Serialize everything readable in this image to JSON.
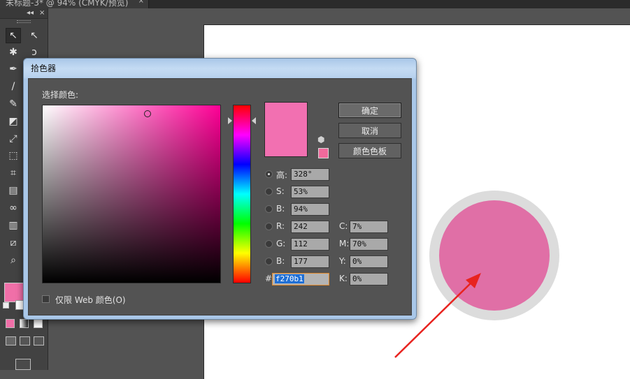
{
  "document_tab": {
    "title": "未标题-3* @ 94% (CMYK/预览)",
    "close": "×"
  },
  "tools_panel": {
    "collapse": "◂◂",
    "close": "×",
    "fill_color": "#f06fa8",
    "tools": [
      {
        "name": "selection-tool",
        "glyph": "↖"
      },
      {
        "name": "direct-selection-tool",
        "glyph": "↖"
      },
      {
        "name": "magic-wand-tool",
        "glyph": "✱"
      },
      {
        "name": "lasso-tool",
        "glyph": "ↄ"
      },
      {
        "name": "pen-tool",
        "glyph": "✒"
      },
      {
        "name": "type-tool",
        "glyph": "T"
      },
      {
        "name": "line-tool",
        "glyph": "/"
      },
      {
        "name": "rectangle-tool",
        "glyph": "▭"
      },
      {
        "name": "paintbrush-tool",
        "glyph": "✎"
      },
      {
        "name": "pencil-tool",
        "glyph": "✏"
      },
      {
        "name": "eraser-tool",
        "glyph": "◩"
      },
      {
        "name": "rotate-tool",
        "glyph": "↻"
      },
      {
        "name": "scale-tool",
        "glyph": "⤢"
      },
      {
        "name": "warp-tool",
        "glyph": "❦"
      },
      {
        "name": "free-transform-tool",
        "glyph": "⬚"
      },
      {
        "name": "shape-builder-tool",
        "glyph": "◎"
      },
      {
        "name": "perspective-grid-tool",
        "glyph": "⌗"
      },
      {
        "name": "mesh-tool",
        "glyph": "#"
      },
      {
        "name": "gradient-tool",
        "glyph": "▤"
      },
      {
        "name": "eyedropper-tool",
        "glyph": "⌖"
      },
      {
        "name": "blend-tool",
        "glyph": "∞"
      },
      {
        "name": "symbol-sprayer-tool",
        "glyph": "⁂"
      },
      {
        "name": "column-graph-tool",
        "glyph": "▥"
      },
      {
        "name": "artboard-tool",
        "glyph": "⊡"
      },
      {
        "name": "slice-tool",
        "glyph": "⧄"
      },
      {
        "name": "hand-tool",
        "glyph": "✋"
      },
      {
        "name": "zoom-tool",
        "glyph": "⌕"
      }
    ]
  },
  "dialog": {
    "title": "拾色器",
    "select_color_label": "选择颜色:",
    "buttons": {
      "ok": "确定",
      "cancel": "取消",
      "swatches": "颜色色板"
    },
    "new_color": "#f270b1",
    "gamut_swatch": "#f06a9c",
    "hsb": {
      "h_label": "高:",
      "h_value": "328°",
      "s_label": "S:",
      "s_value": "53%",
      "b_label": "B:",
      "b_value": "94%"
    },
    "rgb": {
      "r_label": "R:",
      "r_value": "242",
      "g_label": "G:",
      "g_value": "112",
      "b_label": "B:",
      "b_value": "177"
    },
    "hex": {
      "label": "#",
      "value": "f270b1"
    },
    "cmyk": {
      "c_label": "C:",
      "c_value": "7%",
      "m_label": "M:",
      "m_value": "70%",
      "y_label": "Y:",
      "y_value": "0%",
      "k_label": "K:",
      "k_value": "0%"
    },
    "web_only_label": "仅限 Web 颜色(O)"
  },
  "artwork": {
    "circle_fill": "#e06fa6",
    "circle_stroke": "#dcdcdc",
    "arrow_color": "#e8231f"
  }
}
